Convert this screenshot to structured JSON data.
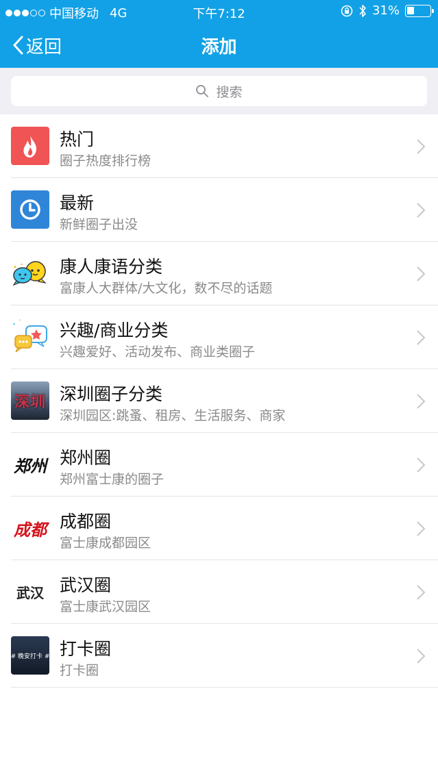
{
  "status_bar": {
    "carrier": "中国移动",
    "network": "4G",
    "time": "下午7:12",
    "battery": "31%",
    "battery_level": 0.31
  },
  "nav": {
    "back_label": "返回",
    "title": "添加"
  },
  "search": {
    "placeholder": "搜索"
  },
  "items": [
    {
      "title": "热门",
      "subtitle": "圈子热度排行榜",
      "icon": "flame-icon"
    },
    {
      "title": "最新",
      "subtitle": "新鲜圈子出没",
      "icon": "clock-icon"
    },
    {
      "title": "康人康语分类",
      "subtitle": "富康人大群体/大文化，数不尽的话题",
      "icon": "chat-faces-icon"
    },
    {
      "title": "兴趣/商业分类",
      "subtitle": "兴趣爱好、活动发布、商业类圈子",
      "icon": "chat-bubbles-icon"
    },
    {
      "title": "深圳圈子分类",
      "subtitle": "深圳园区:跳蚤、租房、生活服务、商家",
      "icon": "shenzhen-icon"
    },
    {
      "title": "郑州圈",
      "subtitle": "郑州富士康的圈子",
      "icon": "zhengzhou-calligraphy-icon"
    },
    {
      "title": "成都圈",
      "subtitle": "富士康成都园区",
      "icon": "chengdu-calligraphy-icon"
    },
    {
      "title": "武汉圈",
      "subtitle": "富士康武汉园区",
      "icon": "wuhan-calligraphy-icon"
    },
    {
      "title": "打卡圈",
      "subtitle": "打卡圈",
      "icon": "checkin-icon"
    }
  ],
  "icon_text": {
    "shenzhen": "深圳",
    "zhengzhou": "郑州",
    "chengdu": "成都",
    "wuhan": "武汉",
    "checkin": "# 晚安打卡 #"
  },
  "colors": {
    "header": "#12a1e6",
    "hot": "#f05454",
    "latest": "#2f86d8"
  }
}
